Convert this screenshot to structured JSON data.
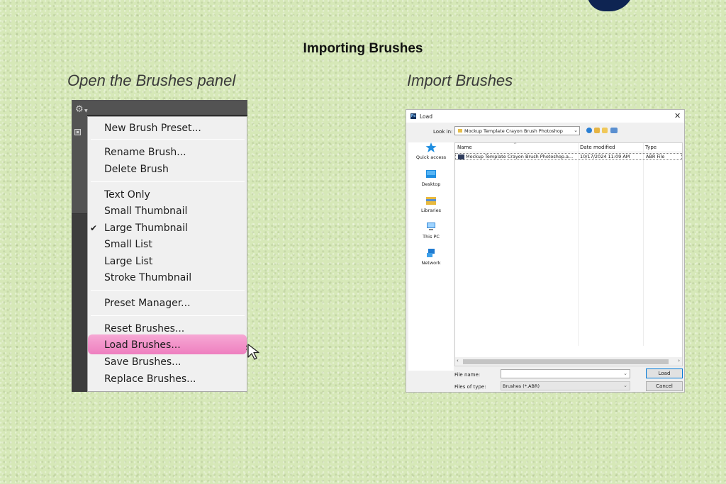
{
  "title": "Importing Brushes",
  "left_step_title": "Open the Brushes panel",
  "right_step_title": "Import Brushes",
  "brushes_menu": {
    "items": [
      {
        "label": "New Brush Preset..."
      },
      {
        "label": "Rename Brush..."
      },
      {
        "label": "Delete Brush"
      },
      {
        "label": "Text Only"
      },
      {
        "label": "Small Thumbnail"
      },
      {
        "label": "Large Thumbnail",
        "checked": true
      },
      {
        "label": "Small List"
      },
      {
        "label": "Large List"
      },
      {
        "label": "Stroke Thumbnail"
      },
      {
        "label": "Preset Manager..."
      },
      {
        "label": "Reset Brushes..."
      },
      {
        "label": "Load Brushes...",
        "highlighted": true
      },
      {
        "label": "Save Brushes..."
      },
      {
        "label": "Replace Brushes..."
      }
    ],
    "check_mark": "✔",
    "highlight_color": "#f29ccb"
  },
  "load_dialog": {
    "app_icon_text": "Ps",
    "title": "Load",
    "close_glyph": "✕",
    "look_in_label": "Look in:",
    "look_in_value": "Mockup Template Crayon Brush Photoshop",
    "places": [
      {
        "label": "Quick access",
        "icon": "star-icon"
      },
      {
        "label": "Desktop",
        "icon": "desktop-icon"
      },
      {
        "label": "Libraries",
        "icon": "libraries-icon"
      },
      {
        "label": "This PC",
        "icon": "computer-icon"
      },
      {
        "label": "Network",
        "icon": "network-icon"
      }
    ],
    "columns": [
      "Name",
      "Date modified",
      "Type"
    ],
    "files": [
      {
        "name": "Mockup Template Crayon Brush Photoshop.a...",
        "date": "10/17/2024 11:09 AM",
        "type": "ABR File"
      }
    ],
    "file_name_label": "File name:",
    "file_name_value": "",
    "files_of_type_label": "Files of type:",
    "files_of_type_value": "Brushes (*.ABR)",
    "load_button": "Load",
    "cancel_button": "Cancel"
  },
  "colors": {
    "background": "#d6e8b8",
    "ps_panel": "#535353",
    "accent_blue": "#0078d7"
  }
}
